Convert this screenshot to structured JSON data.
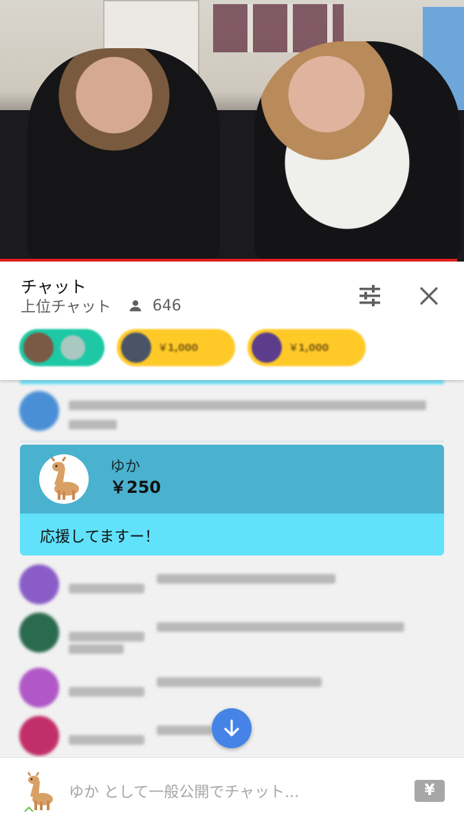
{
  "header": {
    "title": "チャット",
    "subtitle": "上位チャット",
    "viewer_count": "646"
  },
  "tickers": [
    {
      "color": "#1ec8a5",
      "amount": ""
    },
    {
      "color": "#ffca28",
      "amount": "￥1,000"
    },
    {
      "color": "#ffca28",
      "amount": "￥1,000"
    }
  ],
  "super_chat": {
    "name": "ゆか",
    "amount": "￥250",
    "message": "応援してますー！",
    "header_color": "#4ab2cf",
    "body_color": "#61e1fa"
  },
  "messages": [
    {
      "avatar_color": "#4a8fd6"
    },
    {
      "avatar_color": "#8a5cc7"
    },
    {
      "avatar_color": "#2a6a4e"
    },
    {
      "avatar_color": "#b058c6"
    },
    {
      "avatar_color": "#c22e6a"
    }
  ],
  "input": {
    "placeholder": "ゆか として一般公開でチャット...",
    "yen_label": "¥"
  },
  "colors": {
    "scroll_button": "#4584e6",
    "progress": "#e02020"
  }
}
